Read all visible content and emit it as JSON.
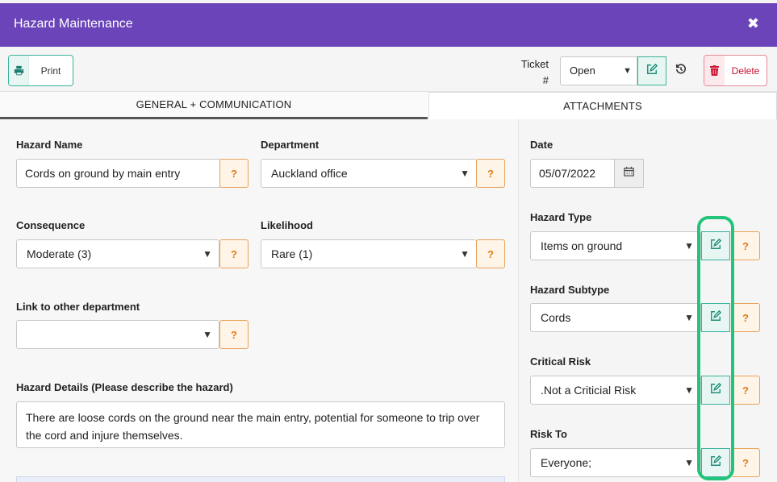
{
  "modal": {
    "title": "Hazard Maintenance",
    "close_icon": "close-icon"
  },
  "toolbar": {
    "print_label": "Print",
    "ticket_label_line1": "Ticket",
    "ticket_label_line2": "#",
    "status_value": "Open",
    "delete_label": "Delete"
  },
  "tabs": [
    {
      "label": "GENERAL + COMMUNICATION",
      "active": true
    },
    {
      "label": "ATTACHMENTS",
      "active": false
    }
  ],
  "form": {
    "hazard_name": {
      "label": "Hazard Name",
      "value": "Cords on ground by main entry"
    },
    "department": {
      "label": "Department",
      "value": "Auckland office"
    },
    "consequence": {
      "label": "Consequence",
      "value": "Moderate (3)"
    },
    "likelihood": {
      "label": "Likelihood",
      "value": "Rare (1)"
    },
    "link_department": {
      "label": "Link to other department",
      "value": ""
    },
    "hazard_details": {
      "label": "Hazard Details (Please describe the hazard)",
      "value": "There are loose cords on the ground near the main entry, potential for someone to trip over the cord and injure themselves."
    },
    "help_glyph": "?"
  },
  "sidebar": {
    "date": {
      "label": "Date",
      "value": "05/07/2022"
    },
    "hazard_type": {
      "label": "Hazard Type",
      "value": "Items on ground"
    },
    "hazard_subtype": {
      "label": "Hazard Subtype",
      "value": "Cords"
    },
    "critical_risk": {
      "label": "Critical Risk",
      "value": ".Not a Criticial Risk"
    },
    "risk_to": {
      "label": "Risk To",
      "value": "Everyone;"
    }
  },
  "colors": {
    "header": "#6a44b8",
    "accent_teal": "#39b29b",
    "help_orange": "#e07b18",
    "delete_red": "#c8102e",
    "highlight_green": "#22c47a"
  }
}
